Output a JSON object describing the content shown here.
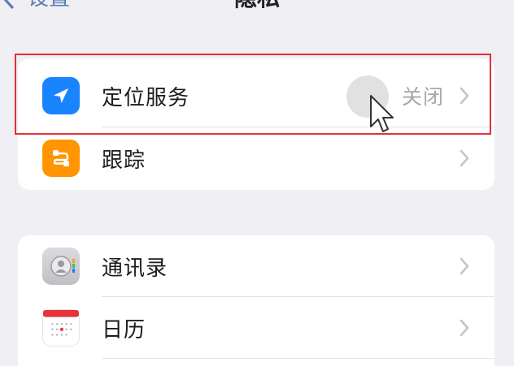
{
  "navbar": {
    "back_label": "设置",
    "title": "隐私"
  },
  "groups": [
    {
      "rows": [
        {
          "label": "定位服务",
          "value": "关闭",
          "icon": "location-arrow-icon",
          "icon_color": "#1a84ff"
        },
        {
          "label": "跟踪",
          "value": "",
          "icon": "tracking-icon",
          "icon_color": "#ff9500"
        }
      ]
    },
    {
      "rows": [
        {
          "label": "通讯录",
          "value": "",
          "icon": "contacts-icon",
          "icon_color": "#c7c7cc"
        },
        {
          "label": "日历",
          "value": "",
          "icon": "calendar-icon",
          "icon_color": "#ffffff"
        }
      ]
    }
  ],
  "colors": {
    "highlight": "#e0323a",
    "background": "#efeff4",
    "accent": "#1a84ff"
  }
}
